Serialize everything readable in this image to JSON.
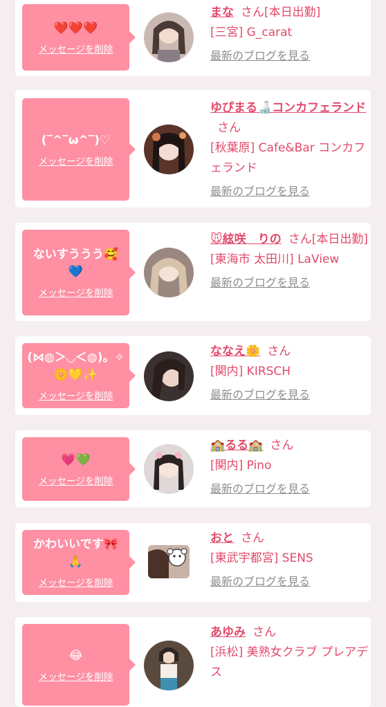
{
  "colors": {
    "accent": "#ff8fa3",
    "link": "#e24a6b",
    "muted": "#8e8e8e",
    "background": "#f4eef0"
  },
  "delete_label": "メッセージを削除",
  "blog_label": "最新のブログを見る",
  "san": "さん",
  "cards": [
    {
      "message": "❤️❤️❤️",
      "name": "まな",
      "suffix": "さん[本日出勤]",
      "shop": "[三宮] G_carat"
    },
    {
      "message": "(‾^‾ω^‾)♡",
      "name": "ゆぴまる🍶コンカフェランド",
      "suffix": "さん",
      "shop": "[秋葉原] Cafe&Bar コンカフェランド"
    },
    {
      "message": "ないすううう🥰💙",
      "name": "🐭絃咲　りの",
      "suffix": "さん[本日出勤]",
      "shop": "[東海市 太田川] LaView"
    },
    {
      "message": "(⋈◍＞◡＜◍)。✧🌼💛✨",
      "name": "ななえ🌼",
      "suffix": "さん",
      "shop": "[関内] KIRSCH"
    },
    {
      "message": "💗💚",
      "name": "🏫るる🏫",
      "suffix": "さん",
      "shop": "[関内] Pino"
    },
    {
      "message": "かわいいです🎀🙏",
      "name": "おと",
      "suffix": "さん",
      "shop": "[東武宇都宮] SENS"
    },
    {
      "message": "😂",
      "name": "あゆみ",
      "suffix": "さん",
      "shop": "[浜松] 美熟女クラブ プレアデス"
    }
  ]
}
